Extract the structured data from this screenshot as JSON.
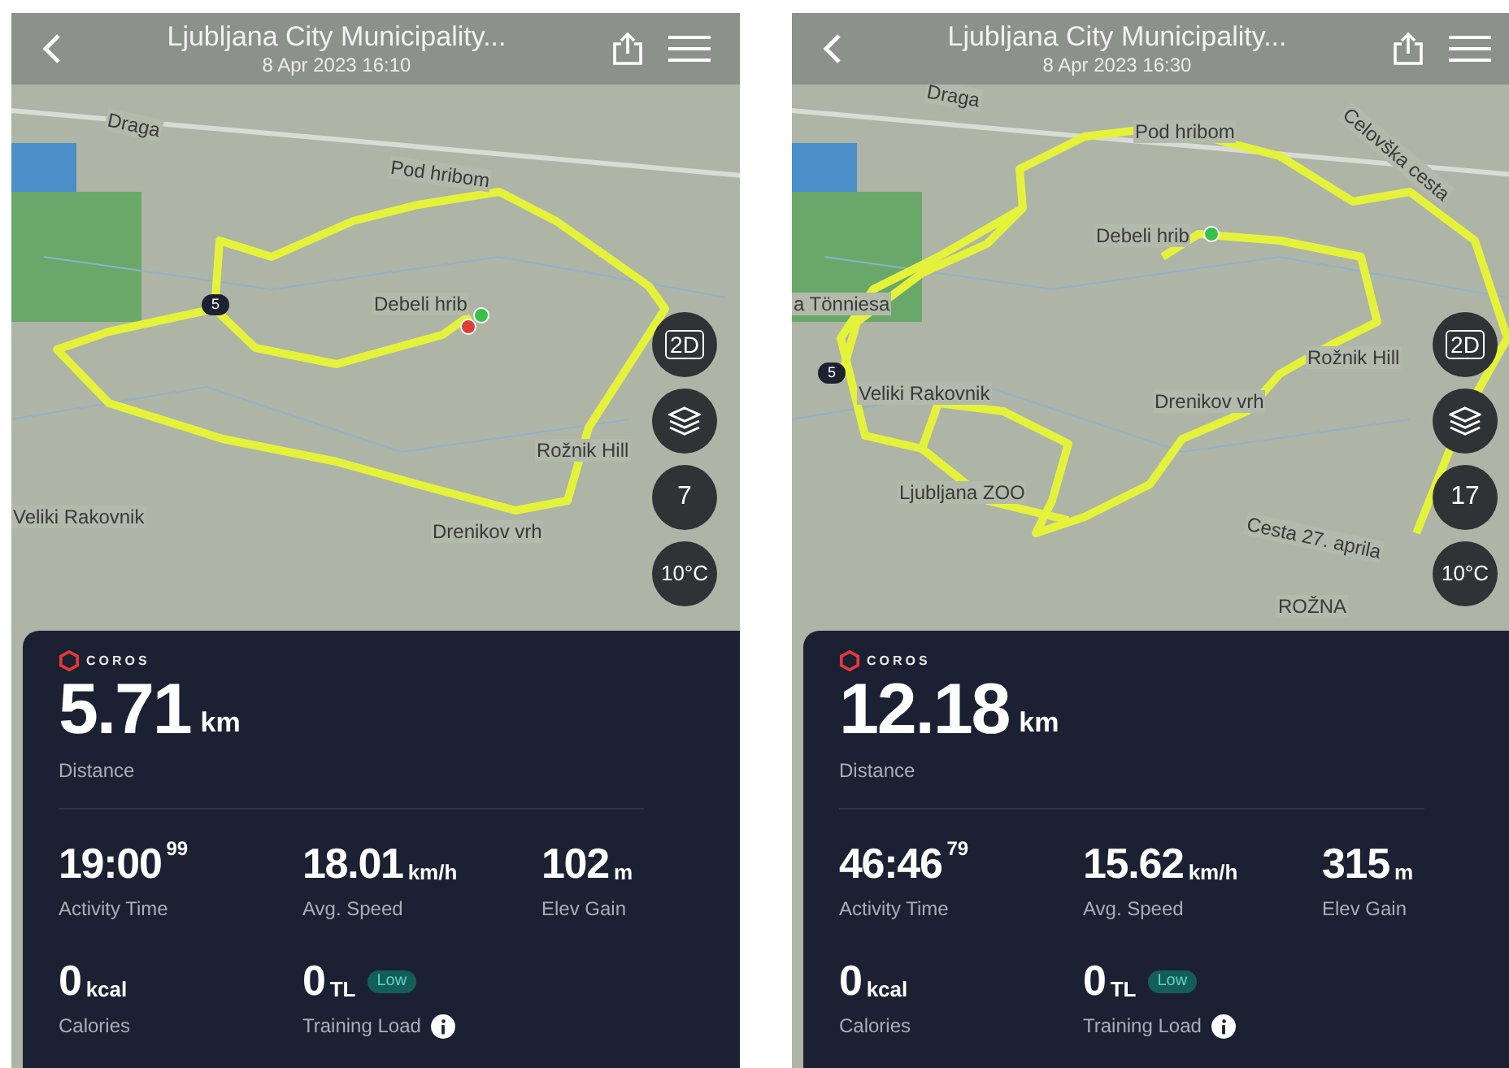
{
  "screens": [
    {
      "header": {
        "title": "Ljubljana City Municipality...",
        "subtitle": "8 Apr 2023 16:10"
      },
      "map": {
        "labels": [
          {
            "text": "Draga"
          },
          {
            "text": "Pod hribom"
          },
          {
            "text": "Debeli hrib"
          },
          {
            "text": "Veliki Rakovnik"
          },
          {
            "text": "Drenikov vrh"
          },
          {
            "text": "Rožnik Hill"
          }
        ],
        "route_badge": "5",
        "mode_button": "2D",
        "compass_reading": "7",
        "temperature": "10°C"
      },
      "card": {
        "logo": "COROS",
        "distance": {
          "value": "5.71",
          "unit": "km",
          "label": "Distance"
        },
        "stats": [
          {
            "kind": "time",
            "value": "19:00",
            "fraction": "99",
            "label": "Activity Time"
          },
          {
            "kind": "speed",
            "value": "18.01",
            "unit": "km/h",
            "label": "Avg. Speed"
          },
          {
            "kind": "elevation",
            "value": "102",
            "unit": "m",
            "label": "Elev Gain"
          },
          {
            "kind": "calories",
            "value": "0",
            "unit": "kcal",
            "label": "Calories"
          },
          {
            "kind": "load",
            "value": "0",
            "unit": "TL",
            "badge": "Low",
            "label": "Training Load"
          }
        ]
      }
    },
    {
      "header": {
        "title": "Ljubljana City Municipality...",
        "subtitle": "8 Apr 2023 16:30"
      },
      "map": {
        "labels": [
          {
            "text": "Draga"
          },
          {
            "text": "Pod hribom"
          },
          {
            "text": "Debeli hrib"
          },
          {
            "text": "a Tönniesa"
          },
          {
            "text": "Veliki Rakovnik"
          },
          {
            "text": "Ljubljana ZOO"
          },
          {
            "text": "Drenikov vrh"
          },
          {
            "text": "Rožnik Hill"
          },
          {
            "text": "Cesta 27. aprila"
          },
          {
            "text": "ROŽNA"
          },
          {
            "text": "Celovška cesta"
          }
        ],
        "route_badge": "5",
        "mode_button": "2D",
        "compass_reading": "17",
        "temperature": "10°C"
      },
      "card": {
        "logo": "COROS",
        "distance": {
          "value": "12.18",
          "unit": "km",
          "label": "Distance"
        },
        "stats": [
          {
            "kind": "time",
            "value": "46:46",
            "fraction": "79",
            "label": "Activity Time"
          },
          {
            "kind": "speed",
            "value": "15.62",
            "unit": "km/h",
            "label": "Avg. Speed"
          },
          {
            "kind": "elevation",
            "value": "315",
            "unit": "m",
            "label": "Elev Gain"
          },
          {
            "kind": "calories",
            "value": "0",
            "unit": "kcal",
            "label": "Calories"
          },
          {
            "kind": "load",
            "value": "0",
            "unit": "TL",
            "badge": "Low",
            "label": "Training Load"
          }
        ]
      }
    }
  ]
}
